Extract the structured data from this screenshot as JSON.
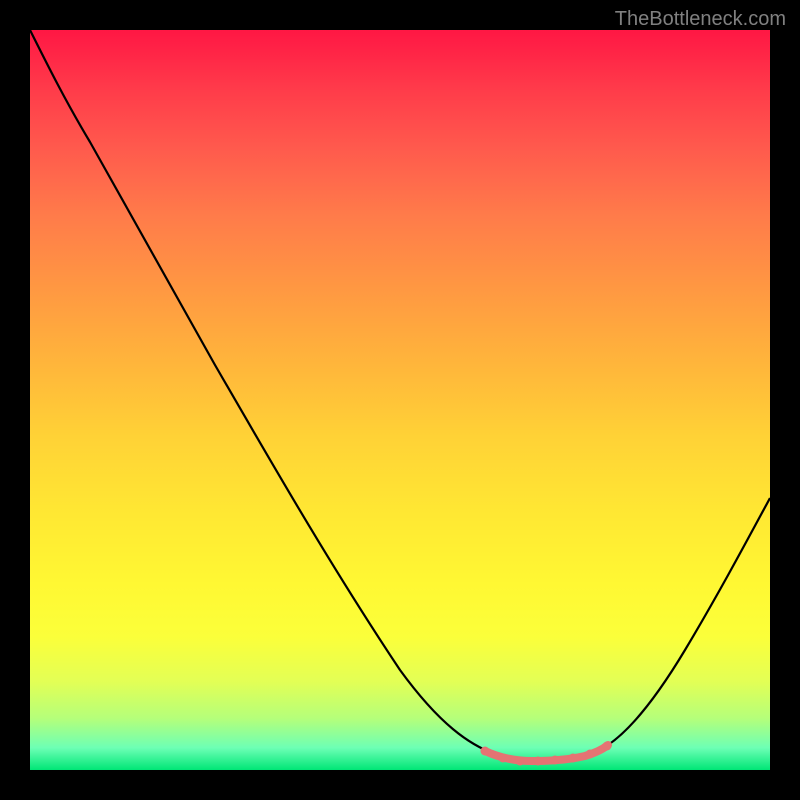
{
  "watermark": "TheBottleneck.com",
  "chart_data": {
    "type": "line",
    "title": "",
    "xlabel": "",
    "ylabel": "",
    "x_range": [
      0,
      100
    ],
    "y_range": [
      0,
      100
    ],
    "grid": false,
    "series": [
      {
        "name": "bottleneck-curve",
        "points": [
          {
            "x": 0,
            "y": 100
          },
          {
            "x": 5,
            "y": 95
          },
          {
            "x": 10,
            "y": 88
          },
          {
            "x": 16,
            "y": 78
          },
          {
            "x": 24,
            "y": 64
          },
          {
            "x": 32,
            "y": 50
          },
          {
            "x": 40,
            "y": 36
          },
          {
            "x": 48,
            "y": 22
          },
          {
            "x": 55,
            "y": 11
          },
          {
            "x": 60,
            "y": 5
          },
          {
            "x": 63,
            "y": 2
          },
          {
            "x": 66,
            "y": 1
          },
          {
            "x": 70,
            "y": 1
          },
          {
            "x": 74,
            "y": 1
          },
          {
            "x": 77,
            "y": 2
          },
          {
            "x": 80,
            "y": 4
          },
          {
            "x": 84,
            "y": 9
          },
          {
            "x": 90,
            "y": 20
          },
          {
            "x": 96,
            "y": 33
          },
          {
            "x": 100,
            "y": 42
          }
        ]
      },
      {
        "name": "optimal-region",
        "points": [
          {
            "x": 62,
            "y": 2.2
          },
          {
            "x": 64,
            "y": 1.3
          },
          {
            "x": 66,
            "y": 1.0
          },
          {
            "x": 68,
            "y": 1.0
          },
          {
            "x": 70,
            "y": 1.0
          },
          {
            "x": 72,
            "y": 1.0
          },
          {
            "x": 74,
            "y": 1.2
          },
          {
            "x": 76,
            "y": 1.8
          },
          {
            "x": 77.5,
            "y": 2.6
          }
        ]
      }
    ],
    "gradient_stops": [
      {
        "offset": 0,
        "color": "#ff1744"
      },
      {
        "offset": 50,
        "color": "#ffd236"
      },
      {
        "offset": 100,
        "color": "#00e676"
      }
    ]
  }
}
